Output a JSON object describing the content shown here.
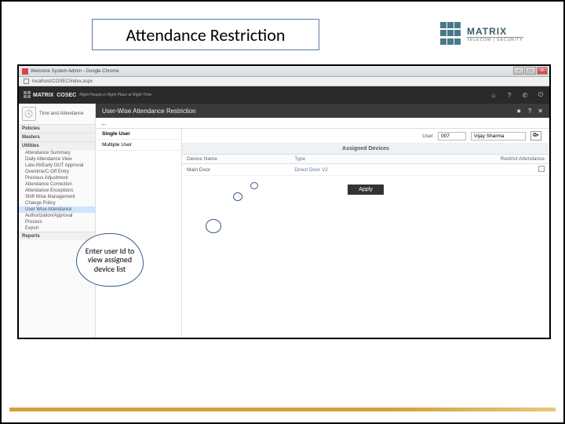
{
  "slide": {
    "title": "Attendance Restriction",
    "logo_brand": "MATRIX",
    "logo_sub": "TELECOM | SECURITY"
  },
  "chrome": {
    "window_title": "Welcome System Admin - Google Chrome",
    "url": "localhost/COSEC/index.aspx"
  },
  "app_header": {
    "brand": "MATRIX",
    "product": "COSEC",
    "tagline": "Right People in Right Place at Right Time"
  },
  "sidebar": {
    "module": "Time and Attendance",
    "groups": [
      {
        "label": "Policies",
        "items": []
      },
      {
        "label": "Masters",
        "items": []
      },
      {
        "label": "Utilities",
        "items": [
          "Attendance Summary",
          "Daily Attendance View",
          "Late-IN/Early OUT Approval",
          "Overtime/C-Off Entry",
          "Previous Adjustment",
          "Attendance Correction",
          "Attendance Exceptions",
          "Shift Wise Management",
          "Change Policy",
          "User Wise Attendance",
          "Authorization/Approval",
          "Process",
          "Export"
        ]
      },
      {
        "label": "Reports",
        "items": []
      }
    ],
    "active_item": "User Wise Attendance"
  },
  "panel": {
    "title": "User-Wise Attendance Restriction",
    "mode_options": {
      "single": "Single User",
      "multiple": "Multiple User"
    },
    "user": {
      "label": "User",
      "id_value": "007",
      "name_value": "Vijay Sharma"
    },
    "assigned_header": "Assigned Devices",
    "table": {
      "cols": {
        "name": "Device Name",
        "type": "Type",
        "restrict": "Restrict Attendance"
      },
      "rows": [
        {
          "name": "Main Door",
          "type": "Direct Door V2",
          "restrict": false
        }
      ]
    },
    "apply_label": "Apply"
  },
  "callout": {
    "text": "Enter user Id  to view assigned device list"
  }
}
